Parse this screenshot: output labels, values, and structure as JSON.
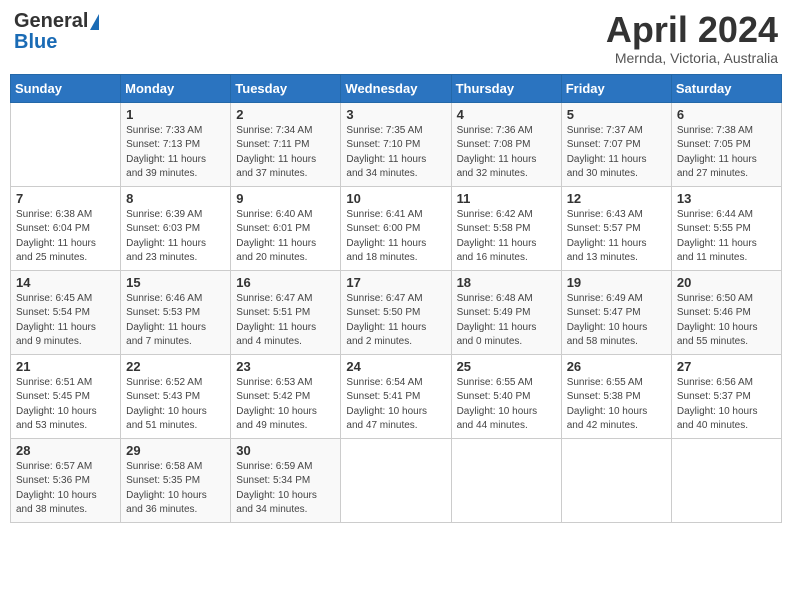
{
  "header": {
    "logo_general": "General",
    "logo_blue": "Blue",
    "month_title": "April 2024",
    "location": "Mernda, Victoria, Australia"
  },
  "days_of_week": [
    "Sunday",
    "Monday",
    "Tuesday",
    "Wednesday",
    "Thursday",
    "Friday",
    "Saturday"
  ],
  "weeks": [
    [
      {
        "day": "",
        "sunrise": "",
        "sunset": "",
        "daylight": ""
      },
      {
        "day": "1",
        "sunrise": "Sunrise: 7:33 AM",
        "sunset": "Sunset: 7:13 PM",
        "daylight": "Daylight: 11 hours and 39 minutes."
      },
      {
        "day": "2",
        "sunrise": "Sunrise: 7:34 AM",
        "sunset": "Sunset: 7:11 PM",
        "daylight": "Daylight: 11 hours and 37 minutes."
      },
      {
        "day": "3",
        "sunrise": "Sunrise: 7:35 AM",
        "sunset": "Sunset: 7:10 PM",
        "daylight": "Daylight: 11 hours and 34 minutes."
      },
      {
        "day": "4",
        "sunrise": "Sunrise: 7:36 AM",
        "sunset": "Sunset: 7:08 PM",
        "daylight": "Daylight: 11 hours and 32 minutes."
      },
      {
        "day": "5",
        "sunrise": "Sunrise: 7:37 AM",
        "sunset": "Sunset: 7:07 PM",
        "daylight": "Daylight: 11 hours and 30 minutes."
      },
      {
        "day": "6",
        "sunrise": "Sunrise: 7:38 AM",
        "sunset": "Sunset: 7:05 PM",
        "daylight": "Daylight: 11 hours and 27 minutes."
      }
    ],
    [
      {
        "day": "7",
        "sunrise": "Sunrise: 6:38 AM",
        "sunset": "Sunset: 6:04 PM",
        "daylight": "Daylight: 11 hours and 25 minutes."
      },
      {
        "day": "8",
        "sunrise": "Sunrise: 6:39 AM",
        "sunset": "Sunset: 6:03 PM",
        "daylight": "Daylight: 11 hours and 23 minutes."
      },
      {
        "day": "9",
        "sunrise": "Sunrise: 6:40 AM",
        "sunset": "Sunset: 6:01 PM",
        "daylight": "Daylight: 11 hours and 20 minutes."
      },
      {
        "day": "10",
        "sunrise": "Sunrise: 6:41 AM",
        "sunset": "Sunset: 6:00 PM",
        "daylight": "Daylight: 11 hours and 18 minutes."
      },
      {
        "day": "11",
        "sunrise": "Sunrise: 6:42 AM",
        "sunset": "Sunset: 5:58 PM",
        "daylight": "Daylight: 11 hours and 16 minutes."
      },
      {
        "day": "12",
        "sunrise": "Sunrise: 6:43 AM",
        "sunset": "Sunset: 5:57 PM",
        "daylight": "Daylight: 11 hours and 13 minutes."
      },
      {
        "day": "13",
        "sunrise": "Sunrise: 6:44 AM",
        "sunset": "Sunset: 5:55 PM",
        "daylight": "Daylight: 11 hours and 11 minutes."
      }
    ],
    [
      {
        "day": "14",
        "sunrise": "Sunrise: 6:45 AM",
        "sunset": "Sunset: 5:54 PM",
        "daylight": "Daylight: 11 hours and 9 minutes."
      },
      {
        "day": "15",
        "sunrise": "Sunrise: 6:46 AM",
        "sunset": "Sunset: 5:53 PM",
        "daylight": "Daylight: 11 hours and 7 minutes."
      },
      {
        "day": "16",
        "sunrise": "Sunrise: 6:47 AM",
        "sunset": "Sunset: 5:51 PM",
        "daylight": "Daylight: 11 hours and 4 minutes."
      },
      {
        "day": "17",
        "sunrise": "Sunrise: 6:47 AM",
        "sunset": "Sunset: 5:50 PM",
        "daylight": "Daylight: 11 hours and 2 minutes."
      },
      {
        "day": "18",
        "sunrise": "Sunrise: 6:48 AM",
        "sunset": "Sunset: 5:49 PM",
        "daylight": "Daylight: 11 hours and 0 minutes."
      },
      {
        "day": "19",
        "sunrise": "Sunrise: 6:49 AM",
        "sunset": "Sunset: 5:47 PM",
        "daylight": "Daylight: 10 hours and 58 minutes."
      },
      {
        "day": "20",
        "sunrise": "Sunrise: 6:50 AM",
        "sunset": "Sunset: 5:46 PM",
        "daylight": "Daylight: 10 hours and 55 minutes."
      }
    ],
    [
      {
        "day": "21",
        "sunrise": "Sunrise: 6:51 AM",
        "sunset": "Sunset: 5:45 PM",
        "daylight": "Daylight: 10 hours and 53 minutes."
      },
      {
        "day": "22",
        "sunrise": "Sunrise: 6:52 AM",
        "sunset": "Sunset: 5:43 PM",
        "daylight": "Daylight: 10 hours and 51 minutes."
      },
      {
        "day": "23",
        "sunrise": "Sunrise: 6:53 AM",
        "sunset": "Sunset: 5:42 PM",
        "daylight": "Daylight: 10 hours and 49 minutes."
      },
      {
        "day": "24",
        "sunrise": "Sunrise: 6:54 AM",
        "sunset": "Sunset: 5:41 PM",
        "daylight": "Daylight: 10 hours and 47 minutes."
      },
      {
        "day": "25",
        "sunrise": "Sunrise: 6:55 AM",
        "sunset": "Sunset: 5:40 PM",
        "daylight": "Daylight: 10 hours and 44 minutes."
      },
      {
        "day": "26",
        "sunrise": "Sunrise: 6:55 AM",
        "sunset": "Sunset: 5:38 PM",
        "daylight": "Daylight: 10 hours and 42 minutes."
      },
      {
        "day": "27",
        "sunrise": "Sunrise: 6:56 AM",
        "sunset": "Sunset: 5:37 PM",
        "daylight": "Daylight: 10 hours and 40 minutes."
      }
    ],
    [
      {
        "day": "28",
        "sunrise": "Sunrise: 6:57 AM",
        "sunset": "Sunset: 5:36 PM",
        "daylight": "Daylight: 10 hours and 38 minutes."
      },
      {
        "day": "29",
        "sunrise": "Sunrise: 6:58 AM",
        "sunset": "Sunset: 5:35 PM",
        "daylight": "Daylight: 10 hours and 36 minutes."
      },
      {
        "day": "30",
        "sunrise": "Sunrise: 6:59 AM",
        "sunset": "Sunset: 5:34 PM",
        "daylight": "Daylight: 10 hours and 34 minutes."
      },
      {
        "day": "",
        "sunrise": "",
        "sunset": "",
        "daylight": ""
      },
      {
        "day": "",
        "sunrise": "",
        "sunset": "",
        "daylight": ""
      },
      {
        "day": "",
        "sunrise": "",
        "sunset": "",
        "daylight": ""
      },
      {
        "day": "",
        "sunrise": "",
        "sunset": "",
        "daylight": ""
      }
    ]
  ]
}
